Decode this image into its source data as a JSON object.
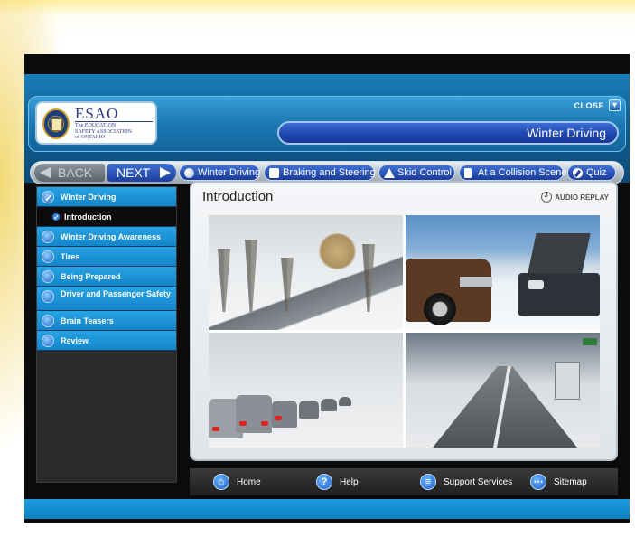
{
  "logo": {
    "title": "ESAO",
    "line1": "The EDUCATION",
    "line2": "SAFETY ASSOCIATION",
    "line3": "of ONTARIO"
  },
  "header": {
    "close_label": "CLOSE",
    "title": "Winter Driving"
  },
  "nav": {
    "back_label": "BACK",
    "next_label": "NEXT",
    "tabs": [
      {
        "label": "Winter Driving",
        "icon": "circle-icon"
      },
      {
        "label": "Braking and Steering",
        "icon": "square-icon"
      },
      {
        "label": "Skid Control",
        "icon": "warning-triangle-icon"
      },
      {
        "label": "At a Collision Scene",
        "icon": "document-icon"
      },
      {
        "label": "Quiz",
        "icon": "pencil-icon"
      }
    ]
  },
  "sidebar": {
    "items": [
      {
        "label": "Winter Driving",
        "checked": true
      },
      {
        "label": "Introduction",
        "sub": true
      },
      {
        "label": "Winter Driving Awareness"
      },
      {
        "label": "Tires"
      },
      {
        "label": "Being Prepared"
      },
      {
        "label": "Driver and Passenger Safety"
      },
      {
        "label": "Brain Teasers"
      },
      {
        "label": "Review"
      }
    ]
  },
  "content": {
    "title": "Introduction",
    "audio_replay": "AUDIO REPLAY"
  },
  "bottom": {
    "home": "Home",
    "help": "Help",
    "support": "Support Services",
    "sitemap": "Sitemap"
  },
  "colors": {
    "accent": "#1485c9",
    "nav_blue": "#1f48b0",
    "footer": "#1c9ee0"
  }
}
